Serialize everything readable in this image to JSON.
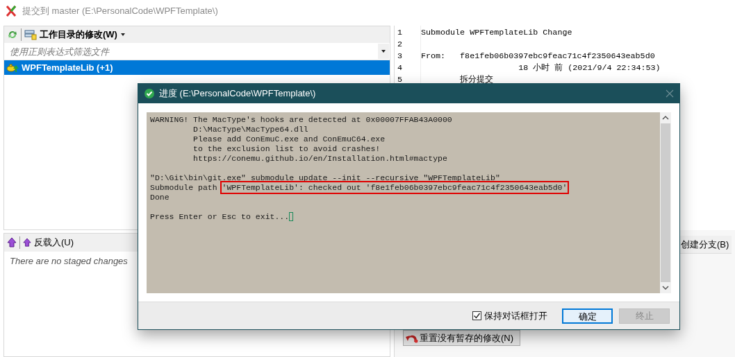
{
  "window": {
    "title": "提交到 master (E:\\PersonalCode\\WPFTemplate\\)"
  },
  "changes_panel": {
    "toolbar_label": "工作目录的修改(W)",
    "filter_placeholder": "使用正则表达式筛选文件",
    "files": [
      {
        "name": "WPFTemplateLib (+1)",
        "selected": true
      }
    ]
  },
  "staged_panel": {
    "toolbar_label": "反载入(U)",
    "empty_text": "There are no staged changes"
  },
  "editor": {
    "lines": [
      {
        "number": "1",
        "text": "Submodule WPFTemplateLib Change"
      },
      {
        "number": "2"
      },
      {
        "number": "3",
        "text": "From:   f8e1feb06b0397ebc9feac71c4f2350643eab5d0"
      },
      {
        "number": "4",
        "text": "                    18 小时 前 (2021/9/4 22:34:53)"
      },
      {
        "number": "5",
        "text": "        拆分提交"
      }
    ]
  },
  "branch_button": "创建分支(B)",
  "reset_button": "重置没有暂存的修改(N)",
  "dialog": {
    "title": "进度 (E:\\PersonalCode\\WPFTemplate\\)",
    "console": [
      {
        "kind": "text",
        "text": "WARNING! The MacType's hooks are detected at 0x00007FFAB43A0000"
      },
      {
        "kind": "text",
        "text": "         D:\\MacType\\MacType64.dll"
      },
      {
        "kind": "text",
        "text": "         Please add ConEmuC.exe and ConEmuC64.exe"
      },
      {
        "kind": "text",
        "text": "         to the exclusion list to avoid crashes!"
      },
      {
        "kind": "text",
        "text": "         https://conemu.github.io/en/Installation.html#mactype"
      },
      {
        "kind": "blank"
      },
      {
        "kind": "text",
        "text": "\"D:\\Git\\bin\\git.exe\" submodule update --init --recursive \"WPFTemplateLib\""
      },
      {
        "kind": "highlighted",
        "text": "Submodule path ",
        "highlight": "'WPFTemplateLib': checked out 'f8e1feb06b0397ebc9feac71c4f2350643eab5d0'"
      },
      {
        "kind": "text",
        "text": "Done"
      },
      {
        "kind": "blank"
      },
      {
        "kind": "prompt",
        "text": "Press Enter or Esc to exit..."
      }
    ],
    "keep_open": {
      "label": "保持对话框打开",
      "checked": true
    },
    "buttons": [
      {
        "label": "确定",
        "focused": true,
        "disabled": false
      },
      {
        "label": "终止",
        "focused": false,
        "disabled": true
      }
    ]
  }
}
